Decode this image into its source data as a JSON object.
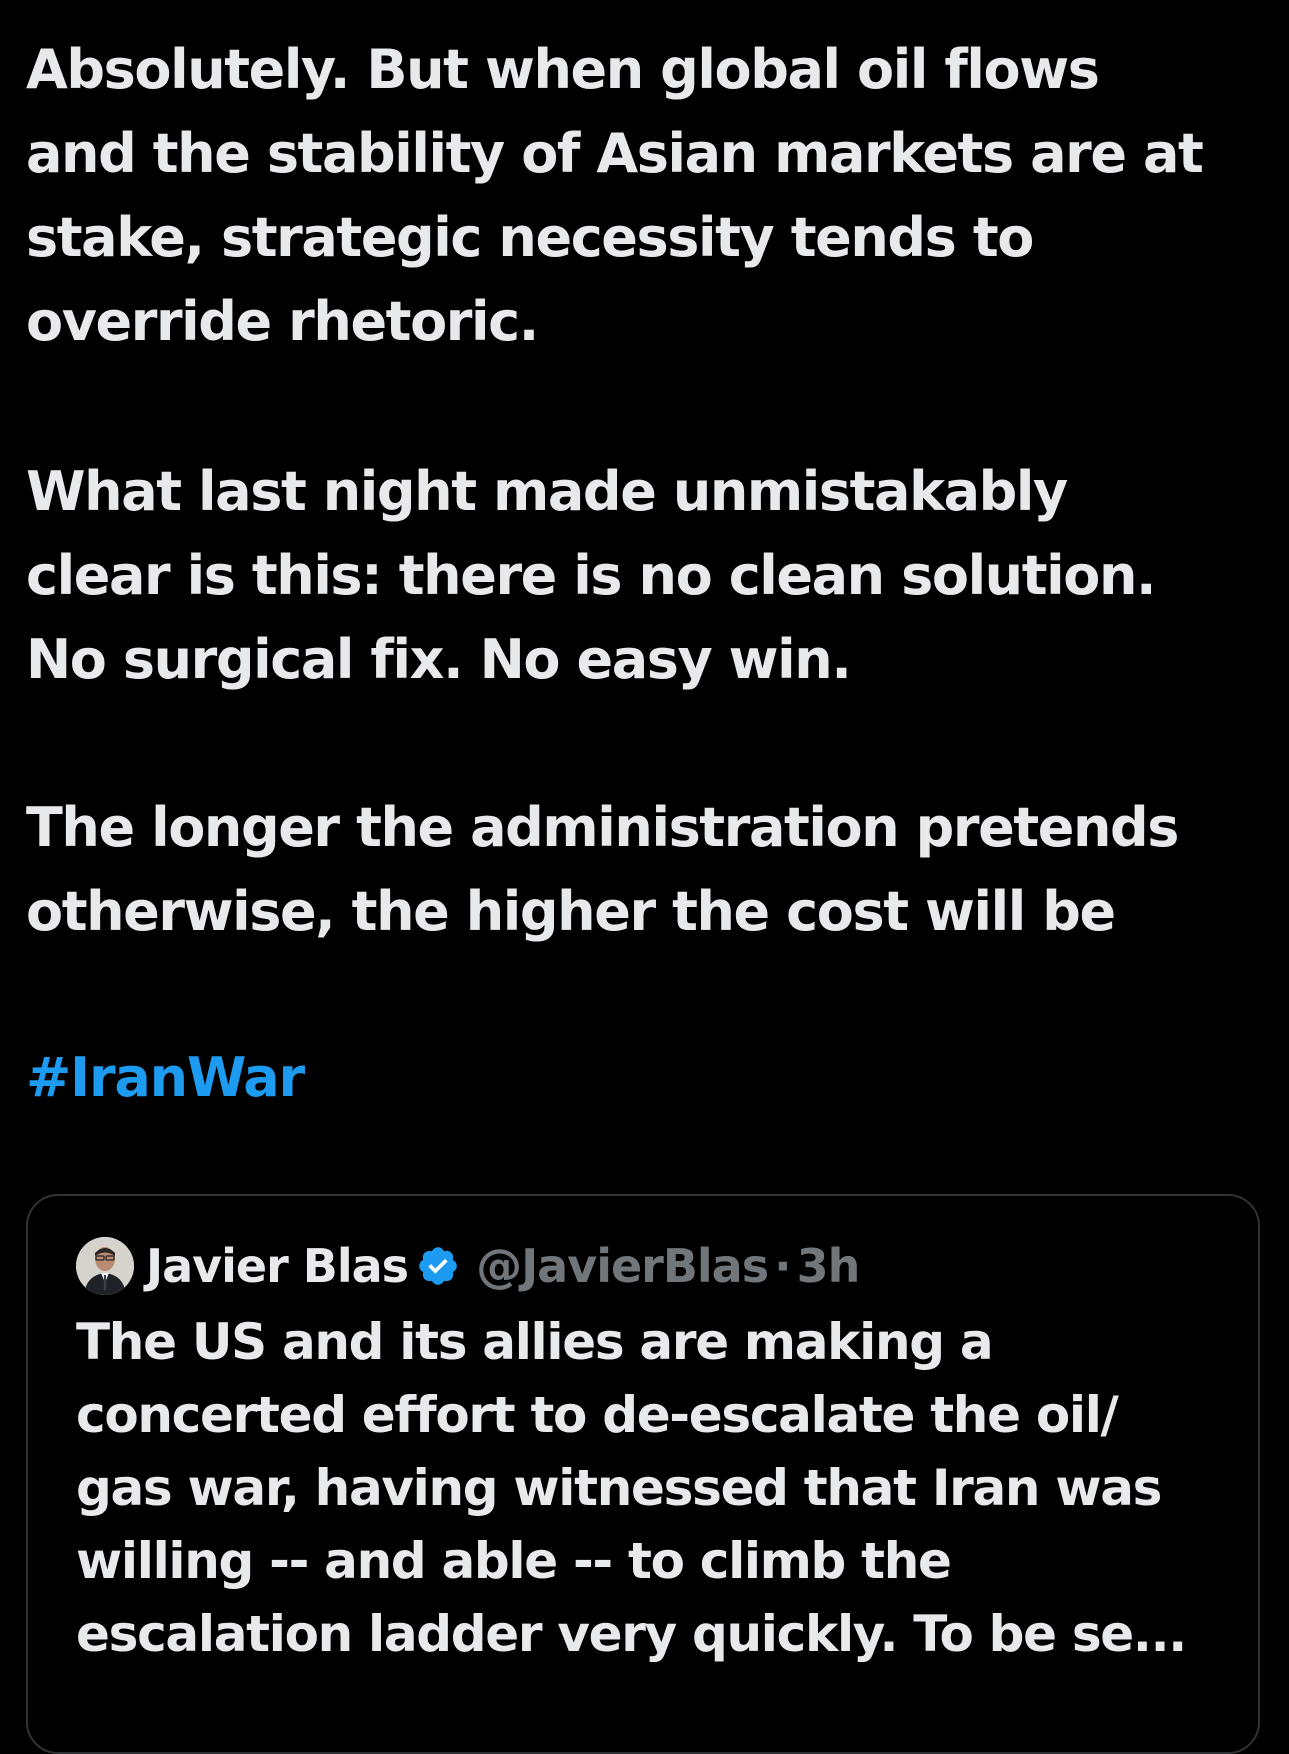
{
  "tweet": {
    "paragraphs": [
      "Absolutely. But when global oil flows\nand the stability of Asian markets are at\nstake, strategic necessity tends to\noverride rhetoric.",
      "What last night made unmistakably\nclear is this: there is no clean solution.\nNo surgical fix. No easy win.",
      "The longer the administration pretends\notherwise, the higher the cost will be"
    ],
    "hashtag": "#IranWar"
  },
  "quoted_tweet": {
    "author_name": "Javier Blas",
    "handle": "@JavierBlas",
    "separator": "·",
    "time": "3h",
    "text": "The US and its allies are making a\nconcerted effort to de-escalate the oil/\ngas war, having witnessed that Iran was\nwilling -- and able -- to climb the\nescalation ladder very quickly. To be se..."
  },
  "icons": {
    "verified": "verified-badge-icon",
    "avatar": "author-avatar"
  },
  "colors": {
    "background": "#000000",
    "text": "#e7e9ea",
    "link": "#1d9bf0",
    "muted": "#71767b",
    "border": "#2f3336"
  }
}
